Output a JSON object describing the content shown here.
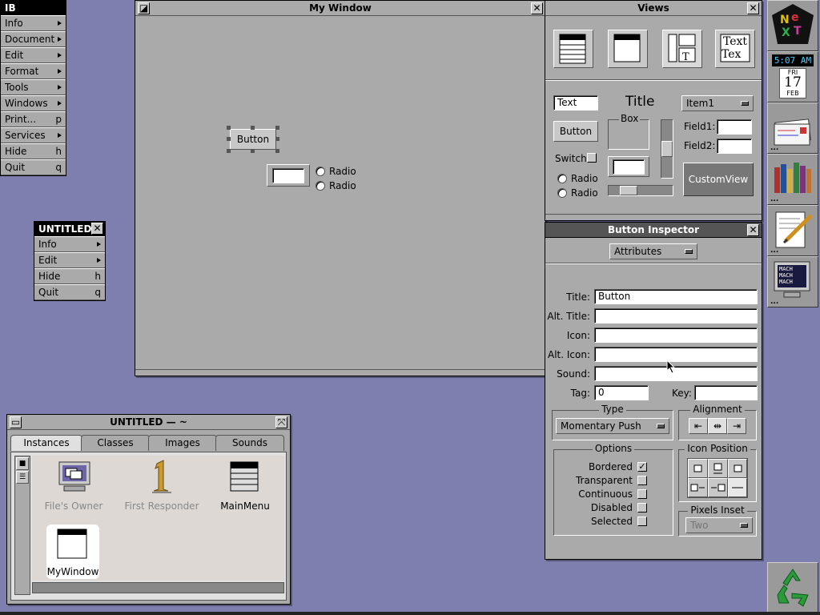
{
  "ib_menu": {
    "title": "IB",
    "items": [
      {
        "label": "Info",
        "key": "",
        "submenu": true
      },
      {
        "label": "Document",
        "key": "",
        "submenu": true
      },
      {
        "label": "Edit",
        "key": "",
        "submenu": true
      },
      {
        "label": "Format",
        "key": "",
        "submenu": true
      },
      {
        "label": "Tools",
        "key": "",
        "submenu": true
      },
      {
        "label": "Windows",
        "key": "",
        "submenu": true
      },
      {
        "label": "Print...",
        "key": "p",
        "submenu": false
      },
      {
        "label": "Services",
        "key": "",
        "submenu": true
      },
      {
        "label": "Hide",
        "key": "h",
        "submenu": false
      },
      {
        "label": "Quit",
        "key": "q",
        "submenu": false
      }
    ]
  },
  "untitled_menu": {
    "title": "UNTITLED",
    "items": [
      {
        "label": "Info",
        "key": "",
        "submenu": true
      },
      {
        "label": "Edit",
        "key": "",
        "submenu": true
      },
      {
        "label": "Hide",
        "key": "h",
        "submenu": false
      },
      {
        "label": "Quit",
        "key": "q",
        "submenu": false
      }
    ]
  },
  "my_window": {
    "title": "My Window",
    "button_label": "Button",
    "radio_1": "Radio",
    "radio_2": "Radio"
  },
  "views_panel": {
    "title": "Views",
    "text_field": "Text",
    "title_label": "Title",
    "popup_label": "Item1",
    "button_label": "Button",
    "box_label": "Box",
    "switch_label": "Switch",
    "radio_1": "Radio",
    "radio_2": "Radio",
    "field1_label": "Field1:",
    "field2_label": "Field2:",
    "customview_label": "CustomView",
    "icon_text_sample": "Text"
  },
  "inspector": {
    "title": "Button Inspector",
    "mode": "Attributes",
    "fields": {
      "title_label": "Title:",
      "title_value": "Button",
      "alt_title_label": "Alt. Title:",
      "alt_title_value": "",
      "icon_label": "Icon:",
      "icon_value": "",
      "alt_icon_label": "Alt. Icon:",
      "alt_icon_value": "",
      "sound_label": "Sound:",
      "sound_value": "",
      "tag_label": "Tag:",
      "tag_value": "0",
      "key_label": "Key:",
      "key_value": ""
    },
    "type_group": "Type",
    "type_value": "Momentary Push",
    "alignment_group": "Alignment",
    "alignment_selected": "center",
    "options_group": "Options",
    "options": [
      {
        "label": "Bordered",
        "checked": true
      },
      {
        "label": "Transparent",
        "checked": false
      },
      {
        "label": "Continuous",
        "checked": false
      },
      {
        "label": "Disabled",
        "checked": false
      },
      {
        "label": "Selected",
        "checked": false
      }
    ],
    "icon_position_group": "Icon Position",
    "pixels_inset_group": "Pixels Inset",
    "pixels_inset_value": "Two"
  },
  "doc_window": {
    "title": "UNTITLED — ~",
    "tabs": [
      "Instances",
      "Classes",
      "Images",
      "Sounds"
    ],
    "active_tab": "Instances",
    "icons": [
      {
        "label": "File's Owner",
        "dimmed": true
      },
      {
        "label": "First Responder",
        "dimmed": true
      },
      {
        "label": "MainMenu",
        "dimmed": false
      },
      {
        "label": "MyWindow",
        "dimmed": false
      }
    ]
  },
  "dock": {
    "clock_time": "5:07 AM",
    "clock_day": "FRI",
    "clock_date": "17",
    "clock_month": "FEB",
    "mach_lines": [
      "MACH",
      "MACH",
      "MACH"
    ]
  },
  "colors": {
    "desktop": "#7f7faf",
    "window": "#aaaaaa",
    "titlebar_active": "#555555",
    "highlight_text": "#ffffff"
  }
}
